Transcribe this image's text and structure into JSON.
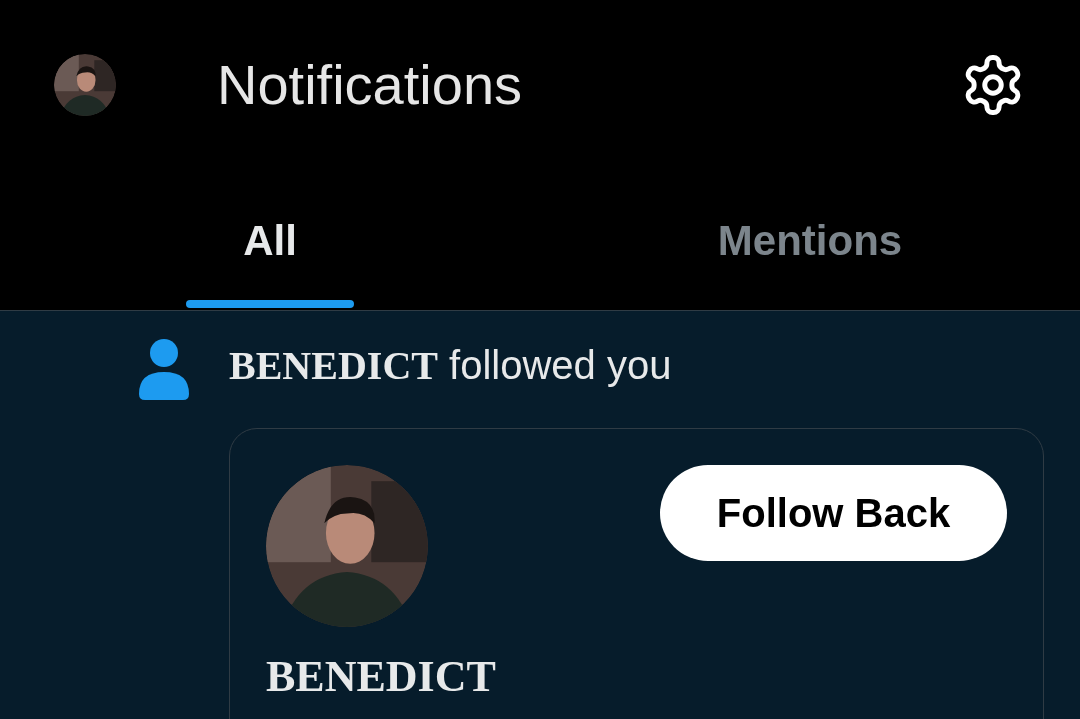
{
  "header": {
    "title": "Notifications"
  },
  "tabs": [
    {
      "label": "All",
      "selected": true
    },
    {
      "label": "Mentions",
      "selected": false
    }
  ],
  "notification": {
    "kind": "follow",
    "actor": "BENEDICT",
    "action": "followed you",
    "card": {
      "name": "BENEDICT",
      "button": "Follow Back"
    }
  }
}
